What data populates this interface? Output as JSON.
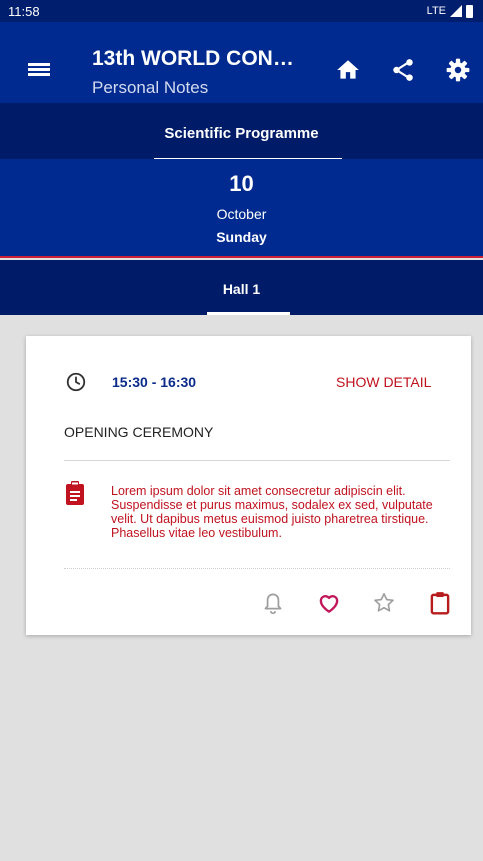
{
  "status_bar": {
    "time": "11:58",
    "network": "LTE"
  },
  "app_bar": {
    "title": "13th WORLD CON…",
    "subtitle": "Personal Notes",
    "icons": [
      "menu-icon",
      "home-icon",
      "share-icon",
      "settings-icon"
    ]
  },
  "tabs": {
    "active_label": "Scientific Programme"
  },
  "date": {
    "day": "10",
    "month": "October",
    "weekday": "Sunday"
  },
  "hall": {
    "label": "Hall 1"
  },
  "session": {
    "time": "15:30 - 16:30",
    "show_detail_label": "SHOW DETAIL",
    "title": "OPENING CEREMONY",
    "note": "Lorem ipsum dolor sit amet consecretur adipiscin elit. Suspendisse et purus maximus, sodalex ex sed, vulputate velit. Ut dapibus metus euismod juisto pharetrea tirstique. Phasellus vitae leo vestibulum.",
    "actions": [
      "bell-icon",
      "heart-icon",
      "star-icon",
      "clipboard-icon"
    ]
  },
  "colors": {
    "primary": "#002a8f",
    "primary_dark": "#001c68",
    "accent_red": "#c0121f",
    "heart": "#c2185b",
    "background": "#e0e0e0"
  }
}
